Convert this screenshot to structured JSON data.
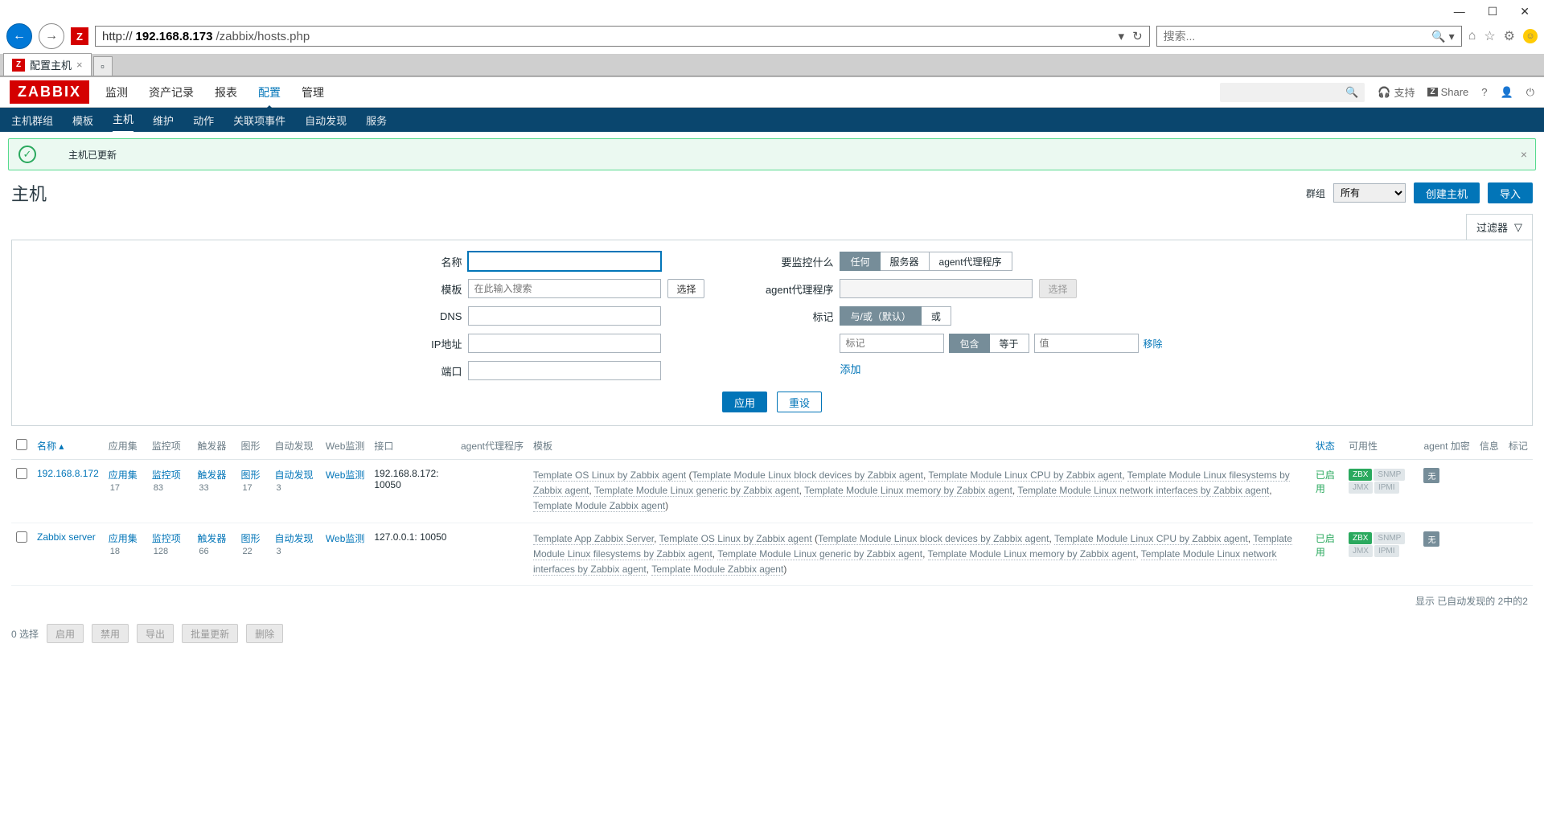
{
  "browser": {
    "url_prefix": "http://",
    "url_bold": "192.168.8.173",
    "url_tail": "/zabbix/hosts.php",
    "search_placeholder": "搜索...",
    "tab_title": "配置主机"
  },
  "top_menu": [
    "监测",
    "资产记录",
    "报表",
    "配置",
    "管理"
  ],
  "top_menu_active": 3,
  "header_right": {
    "support": "支持",
    "share": "Share"
  },
  "sub_nav": [
    "主机群组",
    "模板",
    "主机",
    "维护",
    "动作",
    "关联项事件",
    "自动发现",
    "服务"
  ],
  "sub_nav_active": 2,
  "message": "主机已更新",
  "page_title": "主机",
  "title_bar": {
    "group_label": "群组",
    "group_value": "所有",
    "create_btn": "创建主机",
    "import_btn": "导入"
  },
  "filter_tab": "过滤器",
  "filter": {
    "labels": {
      "name": "名称",
      "template": "模板",
      "dns": "DNS",
      "ip": "IP地址",
      "port": "端口",
      "monitor": "要监控什么",
      "proxy": "agent代理程序",
      "tag": "标记"
    },
    "template_placeholder": "在此输入搜索",
    "select_btn": "选择",
    "monitor_opts": [
      "任何",
      "服务器",
      "agent代理程序"
    ],
    "tag_mode": [
      "与/或（默认）",
      "或"
    ],
    "tag_ph": "标记",
    "tag_contains": "包含",
    "tag_equals": "等于",
    "tag_value_ph": "值",
    "remove": "移除",
    "add": "添加",
    "apply": "应用",
    "reset": "重设"
  },
  "columns": {
    "name": "名称",
    "apps": "应用集",
    "items": "监控项",
    "triggers": "触发器",
    "graphs": "图形",
    "discovery": "自动发现",
    "web": "Web监测",
    "iface": "接口",
    "proxy": "agent代理程序",
    "tpl": "模板",
    "status": "状态",
    "avail": "可用性",
    "enc": "agent 加密",
    "info": "信息",
    "tags": "标记"
  },
  "labels_cell": {
    "apps": "应用集",
    "items": "监控项",
    "triggers": "触发器",
    "graphs": "图形",
    "discovery": "自动发现",
    "web": "Web监测"
  },
  "rows": [
    {
      "name": "192.168.8.172",
      "apps": 17,
      "items": 83,
      "triggers": 33,
      "graphs": 17,
      "discovery": 3,
      "iface": "192.168.8.172: 10050",
      "tpl_main": "Template OS Linux by Zabbix agent",
      "tpl_sub": [
        "Template Module Linux block devices by Zabbix agent",
        "Template Module Linux CPU by Zabbix agent",
        "Template Module Linux filesystems by Zabbix agent",
        "Template Module Linux generic by Zabbix agent",
        "Template Module Linux memory by Zabbix agent",
        "Template Module Linux network interfaces by Zabbix agent",
        "Template Module Zabbix agent"
      ],
      "status": "已启用"
    },
    {
      "name": "Zabbix server",
      "apps": 18,
      "items": 128,
      "triggers": 66,
      "graphs": 22,
      "discovery": 3,
      "iface": "127.0.0.1: 10050",
      "tpl_main_list": [
        "Template App Zabbix Server",
        "Template OS Linux by Zabbix agent"
      ],
      "tpl_sub": [
        "Template Module Linux block devices by Zabbix agent",
        "Template Module Linux CPU by Zabbix agent",
        "Template Module Linux filesystems by Zabbix agent",
        "Template Module Linux generic by Zabbix agent",
        "Template Module Linux memory by Zabbix agent",
        "Template Module Linux network interfaces by Zabbix agent",
        "Template Module Zabbix agent"
      ],
      "status": "已启用"
    }
  ],
  "avail_badges": [
    "ZBX",
    "SNMP",
    "JMX",
    "IPMI"
  ],
  "enc_none": "无",
  "footer": "显示 已自动发现的 2中的2",
  "bottom": {
    "selected": "0 选择",
    "enable": "启用",
    "disable": "禁用",
    "export": "导出",
    "massupdate": "批量更新",
    "delete": "删除"
  }
}
